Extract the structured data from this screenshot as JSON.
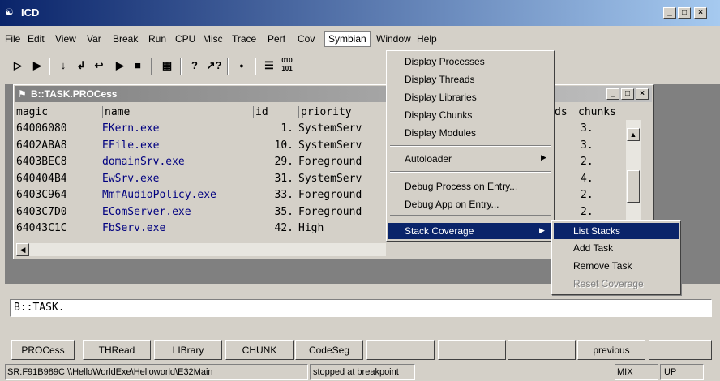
{
  "app": {
    "title": "ICD"
  },
  "menubar": {
    "items": [
      "File",
      "Edit",
      "View",
      "Var",
      "Break",
      "Run",
      "CPU",
      "Misc",
      "Trace",
      "Perf",
      "Cov",
      "Symbian",
      "Window",
      "Help"
    ]
  },
  "child": {
    "title": "B::TASK.PROCess",
    "columns": [
      "magic",
      "name",
      "id",
      "priority",
      "ds",
      "chunks"
    ],
    "rows": [
      {
        "magic": "64006080",
        "name": "EKern.exe",
        "id": "1.",
        "priority": "SystemServ",
        "chunks": "3."
      },
      {
        "magic": "6402ABA8",
        "name": "EFile.exe",
        "id": "10.",
        "priority": "SystemServ",
        "chunks": "3."
      },
      {
        "magic": "6403BEC8",
        "name": "domainSrv.exe",
        "id": "29.",
        "priority": "Foreground",
        "chunks": "2."
      },
      {
        "magic": "640404B4",
        "name": "EwSrv.exe",
        "id": "31.",
        "priority": "SystemServ",
        "chunks": "4."
      },
      {
        "magic": "6403C964",
        "name": "MmfAudioPolicy.exe",
        "id": "33.",
        "priority": "Foreground",
        "chunks": "2."
      },
      {
        "magic": "6403C7D0",
        "name": "EComServer.exe",
        "id": "35.",
        "priority": "Foreground",
        "chunks": "2."
      },
      {
        "magic": "64043C1C",
        "name": "FbServ.exe",
        "id": "42.",
        "priority": "High",
        "chunks": ""
      }
    ]
  },
  "symbian_menu": {
    "items": [
      "Display Processes",
      "Display Threads",
      "Display Libraries",
      "Display Chunks",
      "Display Modules",
      "Autoloader",
      "Debug Process on Entry...",
      "Debug App on Entry...",
      "Stack Coverage"
    ]
  },
  "stack_submenu": {
    "items": [
      "List Stacks",
      "Add Task",
      "Remove Task",
      "Reset Coverage"
    ]
  },
  "cmdline": {
    "value": "B::TASK."
  },
  "buttons": [
    "PROCess",
    "THRead",
    "LIBrary",
    "CHUNK",
    "CodeSeg",
    "previous"
  ],
  "status": {
    "left": "SR:F91B989C  \\\\HelloWorldExe\\Helloworld\\E32Main",
    "state": "stopped at breakpoint",
    "mode": "MIX",
    "dir": "UP"
  }
}
